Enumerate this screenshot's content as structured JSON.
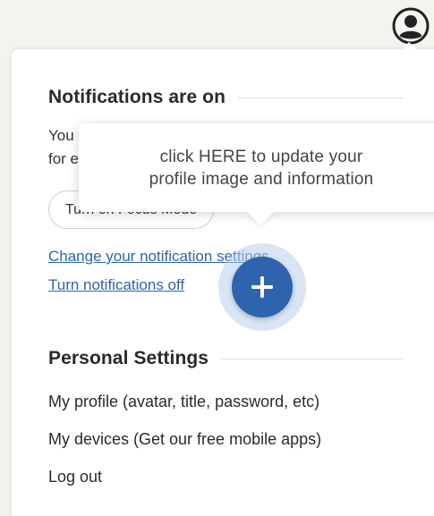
{
  "header": {
    "avatar_icon": "user-circle-icon"
  },
  "notifications": {
    "title": "Notifications are on",
    "desc_line1": "You",
    "desc_line2": "for e",
    "focus_button_label": "Turn on Focus Mode",
    "change_settings_link": "Change your notification settings",
    "turn_off_link": "Turn notifications off"
  },
  "tooltip": {
    "text_line1": "click HERE to update your",
    "text_line2": "profile image and information"
  },
  "fab": {
    "icon": "plus-icon",
    "color": "#2d64ad"
  },
  "personal_settings": {
    "title": "Personal Settings",
    "items": [
      {
        "label": "My profile (avatar, title, password, etc)"
      },
      {
        "label": "My devices (Get our free mobile apps)"
      },
      {
        "label": "Log out"
      }
    ]
  },
  "colors": {
    "link": "#2f63b0",
    "background": "#f5f3f0",
    "panel": "#ffffff"
  }
}
